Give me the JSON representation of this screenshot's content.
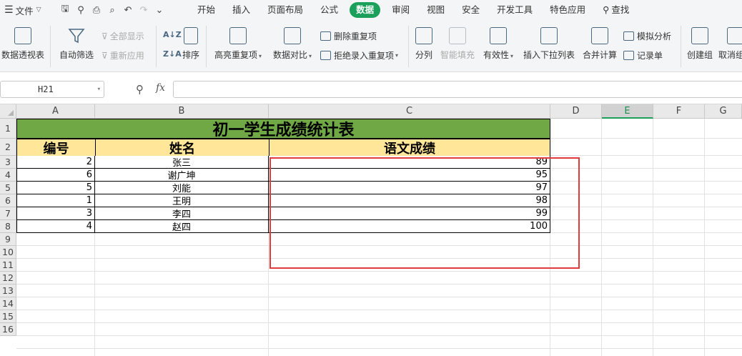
{
  "menubar": {
    "file_label": "文件",
    "tabs": [
      {
        "label": "开始",
        "active": false
      },
      {
        "label": "插入",
        "active": false
      },
      {
        "label": "页面布局",
        "active": false
      },
      {
        "label": "公式",
        "active": false
      },
      {
        "label": "数据",
        "active": true
      },
      {
        "label": "审阅",
        "active": false
      },
      {
        "label": "视图",
        "active": false
      },
      {
        "label": "安全",
        "active": false
      },
      {
        "label": "开发工具",
        "active": false
      },
      {
        "label": "特色应用",
        "active": false
      },
      {
        "label": "查找",
        "active": false
      }
    ],
    "quick_access_icons": [
      "save-icon",
      "format-painter-icon",
      "print-icon",
      "print-preview-icon",
      "undo-icon",
      "redo-icon",
      "customize-icon"
    ]
  },
  "ribbon": {
    "pivot_table": "数据透视表",
    "auto_filter": "自动筛选",
    "show_all": "全部显示",
    "reapply": "重新应用",
    "sort": "排序",
    "highlight_duplicates": "高亮重复项",
    "data_compare": "数据对比",
    "remove_duplicates": "删除重复项",
    "reject_duplicates": "拒绝录入重复项",
    "split": "分列",
    "smart_fill": "智能填充",
    "validity": "有效性",
    "insert_dropdown": "插入下拉列表",
    "consolidate": "合并计算",
    "simulation": "模拟分析",
    "record_form": "记录单",
    "create_group": "创建组",
    "ungroup": "取消组"
  },
  "formula_bar": {
    "cell_ref": "H21",
    "fx_label": "fx",
    "formula": ""
  },
  "sheet": {
    "columns": [
      "A",
      "B",
      "C",
      "D",
      "E",
      "F",
      "G"
    ],
    "selected_column": "E",
    "rows": [
      "1",
      "2",
      "3",
      "4",
      "5",
      "6",
      "7",
      "8",
      "9",
      "10",
      "11",
      "12",
      "13",
      "14",
      "15",
      "16"
    ],
    "title": "初一学生成绩统计表",
    "headers": [
      "编号",
      "姓名",
      "语文成绩"
    ],
    "data": [
      {
        "id": "2",
        "name": "张三",
        "score": "89"
      },
      {
        "id": "6",
        "name": "谢广坤",
        "score": "95"
      },
      {
        "id": "5",
        "name": "刘能",
        "score": "97"
      },
      {
        "id": "1",
        "name": "王明",
        "score": "98"
      },
      {
        "id": "3",
        "name": "李四",
        "score": "99"
      },
      {
        "id": "4",
        "name": "赵四",
        "score": "100"
      }
    ],
    "highlight_color": "#e23b3b",
    "title_fill": "#6fa845",
    "header_fill": "#ffe699"
  }
}
